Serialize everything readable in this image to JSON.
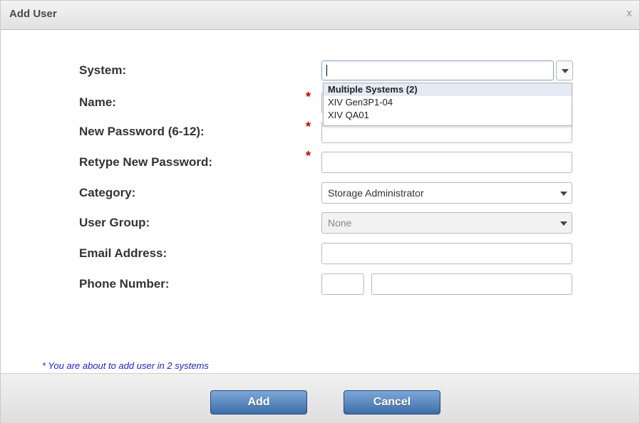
{
  "dialog": {
    "title": "Add User",
    "close_label": "x"
  },
  "fields": {
    "system": {
      "label": "System:",
      "value": ""
    },
    "name": {
      "label": "Name:",
      "value": ""
    },
    "new_password": {
      "label": "New Password (6-12):",
      "value": ""
    },
    "retype_password": {
      "label": "Retype New Password:",
      "value": ""
    },
    "category": {
      "label": "Category:",
      "value": "Storage Administrator"
    },
    "user_group": {
      "label": "User Group:",
      "value": "None"
    },
    "email": {
      "label": "Email Address:",
      "value": ""
    },
    "phone": {
      "label": "Phone Number:",
      "area_value": "",
      "number_value": ""
    }
  },
  "required_marker": "*",
  "system_dropdown": {
    "items": [
      "Multiple Systems (2)",
      "XIV Gen3P1-04",
      "XIV QA01"
    ]
  },
  "footnote": "* You are about to add user in 2 systems",
  "buttons": {
    "add": "Add",
    "cancel": "Cancel"
  },
  "colors": {
    "required": "#c00000",
    "footnote": "#2222cc",
    "button": "#3d6ea9",
    "dropdown_highlight": "#e5ebf4"
  }
}
